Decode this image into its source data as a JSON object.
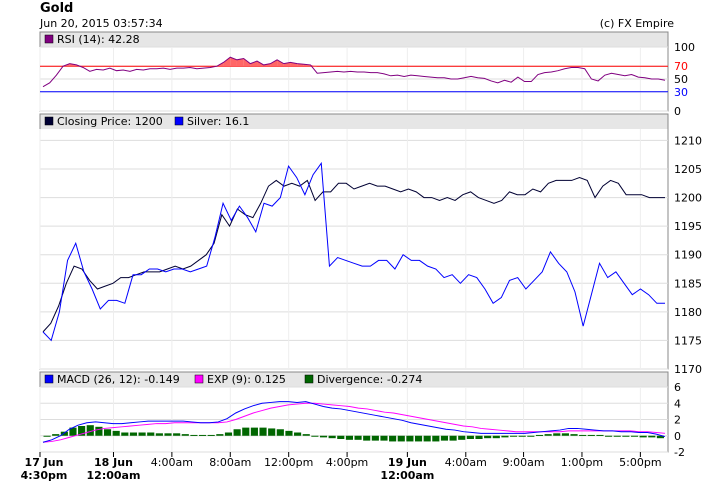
{
  "header": {
    "title": "Gold",
    "timestamp": "Jun 20, 2015 03:57:34",
    "credit": "(c) FX Empire"
  },
  "chart_data": [
    {
      "type": "line",
      "legend": "RSI (14): 42.28",
      "color": "#800080",
      "overbought_color": "#ff0000",
      "oversold_color": "#0000ff",
      "ylim": [
        0,
        100
      ],
      "yticks": [
        0,
        30,
        50,
        70,
        100
      ],
      "overbought": 70,
      "oversold": 30,
      "grid": true,
      "series": [
        {
          "name": "RSI (14)",
          "values": [
            38,
            44,
            56,
            70,
            74,
            72,
            68,
            62,
            65,
            64,
            67,
            63,
            64,
            62,
            65,
            64,
            66,
            66,
            67,
            65,
            67,
            67,
            68,
            66,
            67,
            68,
            70,
            76,
            84,
            80,
            82,
            74,
            78,
            72,
            74,
            80,
            74,
            76,
            74,
            73,
            72,
            59,
            60,
            61,
            62,
            61,
            62,
            61,
            61,
            60,
            60,
            58,
            55,
            56,
            54,
            56,
            55,
            54,
            53,
            52,
            52,
            50,
            50,
            52,
            54,
            52,
            51,
            47,
            44,
            48,
            45,
            53,
            46,
            46,
            57,
            60,
            61,
            63,
            66,
            68,
            68,
            66,
            50,
            47,
            56,
            59,
            57,
            55,
            57,
            53,
            52,
            50,
            50,
            48
          ]
        }
      ]
    },
    {
      "type": "line",
      "legend": [
        {
          "label": "Closing Price: 1200",
          "color": "#000033"
        },
        {
          "label": "Silver: 16.1",
          "color": "#0000ff"
        }
      ],
      "ylim": [
        1170,
        1212
      ],
      "yticks": [
        1170,
        1175,
        1180,
        1185,
        1190,
        1195,
        1200,
        1205,
        1210
      ],
      "grid": true,
      "series": [
        {
          "name": "Closing Price",
          "color": "#000033",
          "values": [
            1176.5,
            1178,
            1181,
            1185,
            1188,
            1187.5,
            1185.5,
            1184,
            1184.5,
            1185,
            1186,
            1186,
            1186.5,
            1187,
            1187,
            1187,
            1187.5,
            1188,
            1187.5,
            1188,
            1189,
            1190,
            1192,
            1197,
            1195,
            1198,
            1197,
            1196.5,
            1199,
            1202,
            1203,
            1202,
            1202.5,
            1202,
            1203,
            1199.5,
            1201,
            1201,
            1202.5,
            1202.5,
            1201.5,
            1202,
            1202.5,
            1202,
            1202,
            1201.5,
            1201,
            1201.5,
            1201,
            1200,
            1200,
            1199.5,
            1200,
            1199.5,
            1200.5,
            1201,
            1200,
            1199.5,
            1199,
            1199.5,
            1201,
            1200.5,
            1200.5,
            1201.5,
            1201,
            1202.5,
            1203,
            1203,
            1203,
            1203.5,
            1203,
            1200,
            1202,
            1203,
            1202.5,
            1200.5,
            1200.5,
            1200.5,
            1200,
            1200,
            1200
          ]
        },
        {
          "name": "Silver",
          "color": "#0000ff",
          "values": [
            1176.5,
            1175,
            1180,
            1189,
            1192,
            1187,
            1184,
            1180.5,
            1182,
            1182,
            1181.5,
            1186.5,
            1186.5,
            1187.5,
            1187.5,
            1187,
            1187.5,
            1187.5,
            1187,
            1187.5,
            1188,
            1193,
            1199,
            1196,
            1198.5,
            1196.5,
            1194,
            1199,
            1198.5,
            1200,
            1205.5,
            1203.5,
            1200.5,
            1204,
            1206,
            1188,
            1189.5,
            1189,
            1188.5,
            1188,
            1188,
            1189,
            1189,
            1187.5,
            1190,
            1189,
            1189,
            1188,
            1187.5,
            1186,
            1186.5,
            1185,
            1186.5,
            1186,
            1184,
            1181.5,
            1182.5,
            1185.5,
            1186,
            1184,
            1185.5,
            1187,
            1190.5,
            1188.5,
            1187,
            1183.5,
            1177.5,
            1183,
            1188.5,
            1186,
            1187,
            1185,
            1183,
            1184,
            1183,
            1181.5,
            1181.5
          ]
        }
      ]
    },
    {
      "type": "bar",
      "legend": [
        {
          "label": "MACD (26, 12): -0.149",
          "color": "#0000ff"
        },
        {
          "label": "EXP (9): 0.125",
          "color": "#ff00ff"
        },
        {
          "label": "Divergence: -0.274",
          "color": "#006600"
        }
      ],
      "ylim": [
        -2,
        6
      ],
      "yticks": [
        -2,
        0,
        2,
        4,
        6
      ],
      "grid": true,
      "macd": [
        -0.8,
        -0.5,
        0,
        0.8,
        1.3,
        1.6,
        1.7,
        1.6,
        1.5,
        1.5,
        1.6,
        1.7,
        1.8,
        1.8,
        1.8,
        1.8,
        1.8,
        1.7,
        1.6,
        1.6,
        1.7,
        2.1,
        2.8,
        3.3,
        3.7,
        4,
        4.1,
        4.2,
        4.2,
        4.1,
        4.2,
        3.9,
        3.6,
        3.4,
        3.3,
        3.1,
        2.9,
        2.7,
        2.5,
        2.3,
        2.1,
        1.9,
        1.6,
        1.4,
        1.2,
        1,
        0.8,
        0.7,
        0.5,
        0.4,
        0.3,
        0.3,
        0.3,
        0.3,
        0.3,
        0.3,
        0.4,
        0.5,
        0.6,
        0.7,
        0.9,
        0.9,
        0.8,
        0.7,
        0.6,
        0.6,
        0.5,
        0.5,
        0.4,
        0.4,
        0.2,
        -0.1
      ],
      "exp": [
        -0.8,
        -0.7,
        -0.5,
        -0.2,
        0.1,
        0.4,
        0.7,
        0.9,
        1,
        1.1,
        1.2,
        1.3,
        1.4,
        1.5,
        1.5,
        1.6,
        1.6,
        1.6,
        1.6,
        1.6,
        1.6,
        1.7,
        2,
        2.4,
        2.8,
        3.1,
        3.4,
        3.6,
        3.8,
        3.9,
        4,
        4,
        3.9,
        3.8,
        3.7,
        3.6,
        3.4,
        3.3,
        3.1,
        2.9,
        2.8,
        2.6,
        2.4,
        2.2,
        2,
        1.8,
        1.6,
        1.4,
        1.2,
        1.1,
        0.9,
        0.8,
        0.7,
        0.6,
        0.5,
        0.5,
        0.5,
        0.5,
        0.5,
        0.5,
        0.6,
        0.6,
        0.6,
        0.6,
        0.6,
        0.6,
        0.6,
        0.6,
        0.5,
        0.5,
        0.4,
        0.3
      ],
      "divergence": [
        0,
        0.2,
        0.5,
        1,
        1.2,
        1.3,
        1.1,
        0.8,
        0.6,
        0.4,
        0.4,
        0.4,
        0.4,
        0.3,
        0.3,
        0.3,
        0.2,
        0.1,
        0.1,
        0.1,
        0.2,
        0.4,
        0.8,
        1,
        1,
        1,
        0.9,
        0.8,
        0.6,
        0.4,
        0.2,
        0,
        -0.2,
        -0.3,
        -0.4,
        -0.5,
        -0.5,
        -0.6,
        -0.6,
        -0.6,
        -0.7,
        -0.7,
        -0.7,
        -0.7,
        -0.7,
        -0.7,
        -0.6,
        -0.6,
        -0.5,
        -0.4,
        -0.4,
        -0.3,
        -0.3,
        -0.2,
        -0.1,
        0,
        0,
        0.1,
        0.2,
        0.3,
        0.3,
        0.2,
        0.1,
        0.1,
        0.1,
        0,
        -0.1,
        -0.1,
        -0.1,
        -0.2,
        -0.2,
        -0.3
      ]
    }
  ],
  "x_axis": {
    "labels": [
      {
        "main": "17 Jun",
        "sub": "4:30pm",
        "bold": true,
        "pos": 0
      },
      {
        "main": "18 Jun",
        "sub": "12:00am",
        "bold": true,
        "pos": 0.117
      },
      {
        "main": "4:00am",
        "sub": "",
        "bold": false,
        "pos": 0.21
      },
      {
        "main": "8:00am",
        "sub": "",
        "bold": false,
        "pos": 0.303
      },
      {
        "main": "12:00pm",
        "sub": "",
        "bold": false,
        "pos": 0.396
      },
      {
        "main": "4:00pm",
        "sub": "",
        "bold": false,
        "pos": 0.489
      },
      {
        "main": "19 Jun",
        "sub": "12:00am",
        "bold": true,
        "pos": 0.585
      },
      {
        "main": "4:00am",
        "sub": "",
        "bold": false,
        "pos": 0.678
      },
      {
        "main": "9:00am",
        "sub": "",
        "bold": false,
        "pos": 0.77
      },
      {
        "main": "1:00pm",
        "sub": "",
        "bold": false,
        "pos": 0.863
      },
      {
        "main": "5:00pm",
        "sub": "",
        "bold": false,
        "pos": 0.956
      }
    ]
  }
}
